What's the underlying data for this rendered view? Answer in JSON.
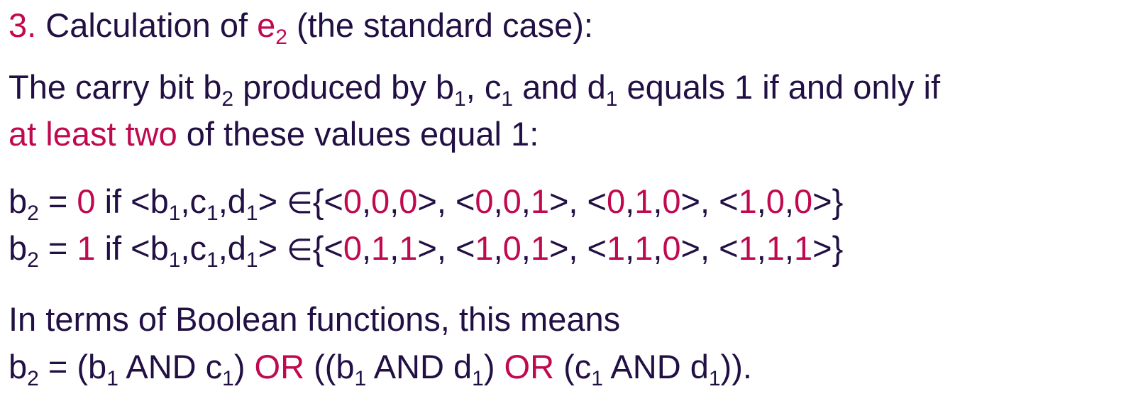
{
  "heading": {
    "number": "3.",
    "text_before": " Calculation of ",
    "var": "e",
    "var_sub": "2",
    "text_after": " (the standard case):"
  },
  "intro": {
    "t1": "The carry bit b",
    "t1_sub": "2",
    "t2": " produced by b",
    "t2_sub": "1",
    "t3": ", c",
    "t3_sub": "1",
    "t4": " and d",
    "t4_sub": "1",
    "t5": " equals 1 if and only if",
    "highlight": "at least two",
    "t6": " of these values equal 1:"
  },
  "rules": {
    "row0": {
      "lhs": "b",
      "lhs_sub": "2",
      "eq": " = ",
      "value": "0",
      "cond": " if <b",
      "sub_b": "1",
      "c_label": ",c",
      "sub_c": "1",
      "d_label": ",d",
      "sub_d": "1",
      "close": "> ",
      "element_of": "∈",
      "tuples": [
        [
          "0",
          "0",
          "0"
        ],
        [
          "0",
          "0",
          "1"
        ],
        [
          "0",
          "1",
          "0"
        ],
        [
          "1",
          "0",
          "0"
        ]
      ]
    },
    "row1": {
      "lhs": "b",
      "lhs_sub": "2",
      "eq": " = ",
      "value": "1",
      "cond": " if <b",
      "sub_b": "1",
      "c_label": ",c",
      "sub_c": "1",
      "d_label": ",d",
      "sub_d": "1",
      "close": "> ",
      "element_of": "∈",
      "tuples": [
        [
          "0",
          "1",
          "1"
        ],
        [
          "1",
          "0",
          "1"
        ],
        [
          "1",
          "1",
          "0"
        ],
        [
          "1",
          "1",
          "1"
        ]
      ]
    }
  },
  "boolean": {
    "intro": "In terms of Boolean functions, this means",
    "f_lhs": "b",
    "f_lhs_sub": "2",
    "f1": " = (b",
    "f1_sub": "1",
    "f2": " AND c",
    "f2_sub": "1",
    "f3": ") ",
    "or1": "OR",
    "f4": " ((b",
    "f4_sub": "1",
    "f5": " AND d",
    "f5_sub": "1",
    "f6": ") ",
    "or2": "OR",
    "f7": " (c",
    "f7_sub": "1",
    "f8": " AND d",
    "f8_sub": "1",
    "f9": "))."
  },
  "colors": {
    "text": "#221045",
    "highlight": "#c0094f"
  }
}
